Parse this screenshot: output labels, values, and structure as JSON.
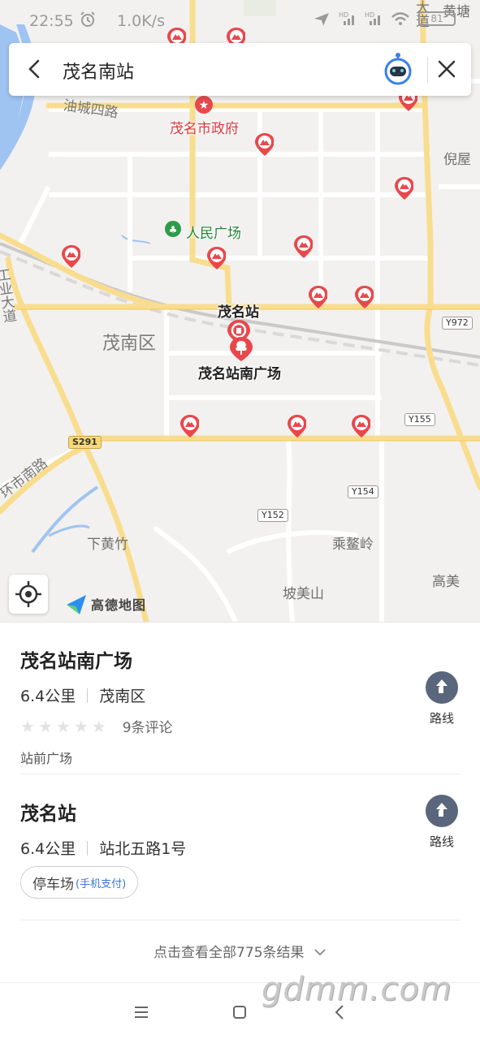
{
  "status": {
    "time": "22:55",
    "speed": "1.0K/s",
    "battery": "81"
  },
  "search": {
    "query": "茂名南站"
  },
  "map": {
    "roads": [
      "油城四路",
      "工业大道",
      "大道",
      "环市南路"
    ],
    "places": [
      "黄塘",
      "倪屋",
      "茂南区",
      "下黄竹",
      "乘鳌岭",
      "高美",
      "坡美山"
    ],
    "badges": [
      "Y972",
      "Y155",
      "S291",
      "Y154",
      "Y152"
    ],
    "poi": {
      "city_gov": "茂名市政府",
      "square": "人民广场",
      "station": "茂名站",
      "south_square": "茂名站南广场"
    },
    "logo": "高德地图"
  },
  "results": [
    {
      "title": "茂名站南广场",
      "distance": "6.4公里",
      "address": "茂南区",
      "reviews": "9条评论",
      "category": "站前广场",
      "route_label": "路线"
    },
    {
      "title": "茂名站",
      "distance": "6.4公里",
      "address": "站北五路1号",
      "tag_main": "停车场",
      "tag_note": "(手机支付)",
      "route_label": "路线"
    }
  ],
  "footer": {
    "see_all": "点击查看全部775条结果"
  },
  "watermark": "gdmm.com"
}
